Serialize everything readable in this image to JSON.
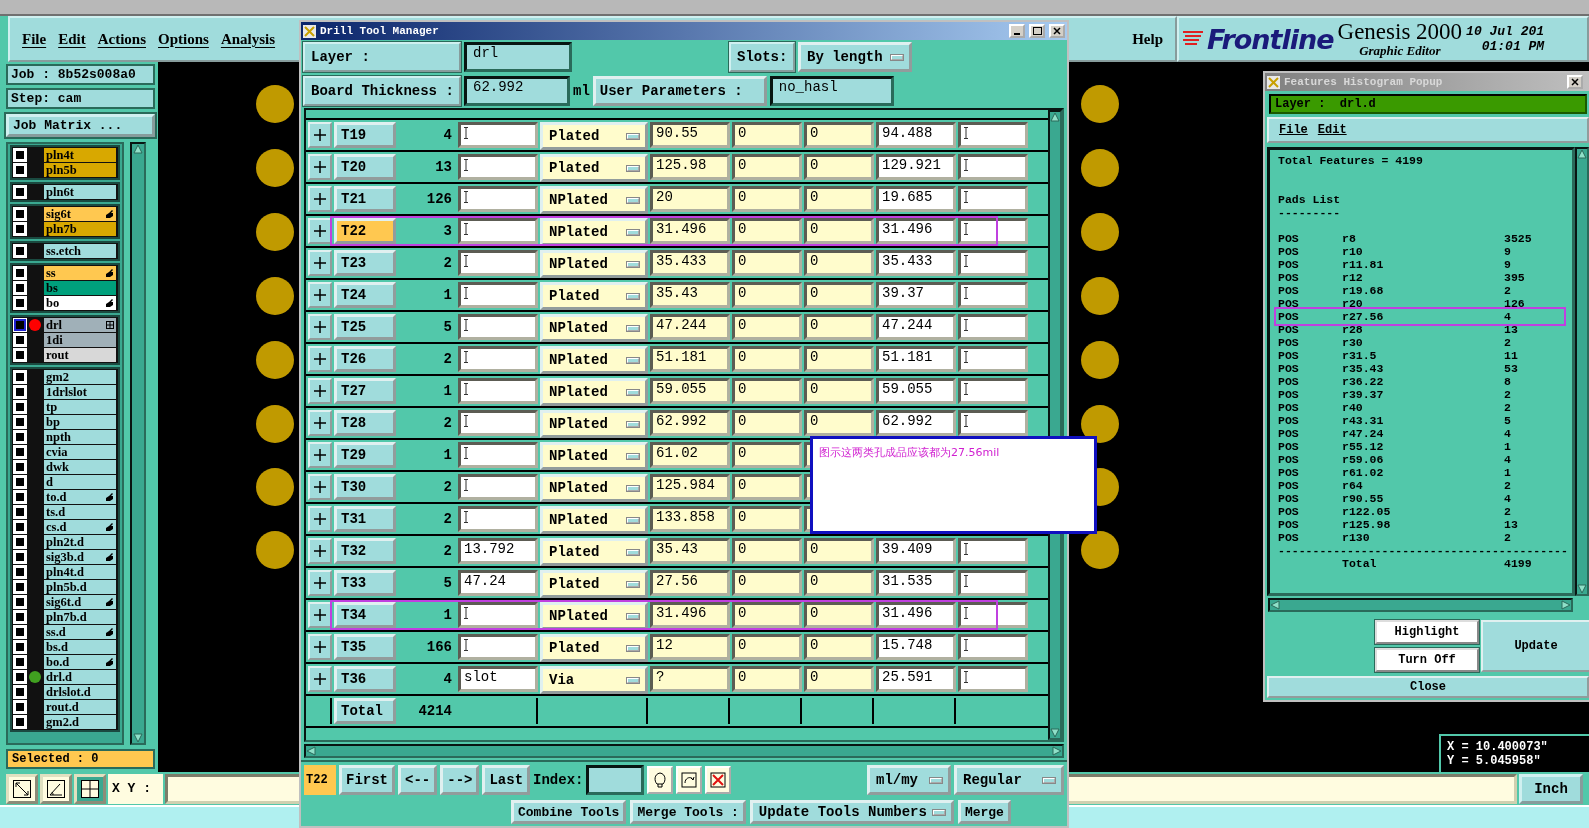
{
  "main_window": {
    "menu": [
      "File",
      "Edit",
      "Actions",
      "Options",
      "Analysis"
    ],
    "help": "Help",
    "logo": {
      "brand": "Frontline",
      "product": "Genesis 2000",
      "subtitle": "Graphic Editor",
      "date": "10 Jul 201",
      "time": "01:01 PM"
    }
  },
  "job_panel": {
    "job": "Job : 8b52s008a0",
    "step": "Step: cam",
    "matrix_button": "Job Matrix ...",
    "selected_count": "Selected : 0",
    "layer_groups": [
      [
        {
          "name": "pln4t",
          "color": "#d8a800",
          "checked": false,
          "selected": false,
          "kind": "plain"
        },
        {
          "name": "pln5b",
          "color": "#d8a800",
          "checked": false,
          "selected": false,
          "kind": "plain"
        }
      ],
      [
        {
          "name": "pln6t",
          "color": "#a0dcdc",
          "checked": false,
          "selected": false,
          "kind": "plain"
        }
      ],
      [
        {
          "name": "sig6t",
          "color": "#ffc850",
          "checked": false,
          "selected": false,
          "kind": "hand"
        },
        {
          "name": "pln7b",
          "color": "#d8a800",
          "checked": false,
          "selected": false,
          "kind": "plain"
        }
      ],
      [
        {
          "name": "ss.etch",
          "color": "#a0dcdc",
          "checked": false,
          "selected": false,
          "kind": "plain"
        }
      ],
      [
        {
          "name": "ss",
          "color": "#ffc850",
          "checked": false,
          "selected": false,
          "kind": "hand"
        },
        {
          "name": "bs",
          "color": "#00a07c",
          "checked": false,
          "selected": false,
          "kind": "plain"
        },
        {
          "name": "bo",
          "color": "#ffffff",
          "checked": false,
          "selected": false,
          "kind": "hand"
        }
      ],
      [
        {
          "name": "drl",
          "color": "#a0b0b8",
          "checked": false,
          "selected": true,
          "dot": {
            "color": "#ff0000"
          },
          "kind": "grid"
        },
        {
          "name": "1di",
          "color": "#a0b0b8",
          "checked": false,
          "selected": false,
          "kind": "plain"
        },
        {
          "name": "rout",
          "color": "#d8d8d8",
          "checked": false,
          "selected": false,
          "kind": "plain"
        }
      ],
      [
        {
          "name": "gm2",
          "color": "#a0dcdc",
          "checked": false,
          "selected": false,
          "kind": "plain"
        },
        {
          "name": "1drlslot",
          "color": "#a0dcdc",
          "checked": false,
          "selected": false,
          "kind": "plain"
        },
        {
          "name": "tp",
          "color": "#a0dcdc",
          "checked": false,
          "selected": false,
          "kind": "plain"
        },
        {
          "name": "bp",
          "color": "#a0dcdc",
          "checked": false,
          "selected": false,
          "kind": "plain"
        },
        {
          "name": "npth",
          "color": "#a0dcdc",
          "checked": false,
          "selected": false,
          "kind": "plain"
        },
        {
          "name": "cvia",
          "color": "#a0dcdc",
          "checked": false,
          "selected": false,
          "kind": "plain"
        },
        {
          "name": "dwk",
          "color": "#a0dcdc",
          "checked": false,
          "selected": false,
          "kind": "plain"
        },
        {
          "name": "d",
          "color": "#a0dcdc",
          "checked": false,
          "selected": false,
          "kind": "plain"
        },
        {
          "name": "to.d",
          "color": "#a0dcdc",
          "checked": false,
          "selected": false,
          "kind": "hand"
        },
        {
          "name": "ts.d",
          "color": "#a0dcdc",
          "checked": false,
          "selected": false,
          "kind": "plain"
        },
        {
          "name": "cs.d",
          "color": "#a0dcdc",
          "checked": false,
          "selected": false,
          "kind": "hand"
        },
        {
          "name": "pln2t.d",
          "color": "#a0dcdc",
          "checked": false,
          "selected": false,
          "kind": "plain"
        },
        {
          "name": "sig3b.d",
          "color": "#a0dcdc",
          "checked": false,
          "selected": false,
          "kind": "hand"
        },
        {
          "name": "pln4t.d",
          "color": "#a0dcdc",
          "checked": false,
          "selected": false,
          "kind": "plain"
        },
        {
          "name": "pln5b.d",
          "color": "#a0dcdc",
          "checked": false,
          "selected": false,
          "kind": "plain"
        },
        {
          "name": "sig6t.d",
          "color": "#a0dcdc",
          "checked": false,
          "selected": false,
          "kind": "hand"
        },
        {
          "name": "pln7b.d",
          "color": "#a0dcdc",
          "checked": false,
          "selected": false,
          "kind": "plain"
        },
        {
          "name": "ss.d",
          "color": "#a0dcdc",
          "checked": false,
          "selected": false,
          "kind": "hand"
        },
        {
          "name": "bs.d",
          "color": "#a0dcdc",
          "checked": false,
          "selected": false,
          "kind": "plain"
        },
        {
          "name": "bo.d",
          "color": "#a0dcdc",
          "checked": false,
          "selected": false,
          "kind": "hand"
        },
        {
          "name": "drl.d",
          "color": "#a0dcdc",
          "checked": false,
          "selected": false,
          "dot": {
            "color": "#40a020"
          },
          "kind": "plain"
        },
        {
          "name": "drlslot.d",
          "color": "#a0dcdc",
          "checked": false,
          "selected": false,
          "kind": "plain"
        },
        {
          "name": "rout.d",
          "color": "#a0dcdc",
          "checked": false,
          "selected": false,
          "kind": "plain"
        },
        {
          "name": "gm2.d",
          "color": "#a0dcdc",
          "checked": false,
          "selected": false,
          "kind": "plain"
        }
      ]
    ]
  },
  "toolbar": {
    "xy_label": "X Y :",
    "unit": "Inch"
  },
  "coordinates": {
    "x": "X = 10.400073\"",
    "y": "Y = 5.045958\""
  },
  "drill_tool_manager": {
    "title": "Drill Tool Manager",
    "layer_label": "Layer :",
    "layer": "drl",
    "slots_label": "Slots:",
    "slots": "By length",
    "thickness_label": "Board Thickness :",
    "thickness": "62.992",
    "thickness_unit": "ml",
    "user_params_button": "User Parameters :",
    "user_params": "no_hasl",
    "rows": [
      {
        "tool": "T19",
        "count": "4",
        "type": "Plated",
        "column_5": "90.55",
        "column_6": "0",
        "column_7": "0",
        "column_8": "94.488",
        "selected": false,
        "circled": false
      },
      {
        "tool": "T20",
        "count": "13",
        "type": "Plated",
        "column_5": "125.98",
        "column_6": "0",
        "column_7": "0",
        "column_8": "129.921",
        "selected": false,
        "circled": false
      },
      {
        "tool": "T21",
        "count": "126",
        "type": "NPlated",
        "column_5": "20",
        "column_6": "0",
        "column_7": "0",
        "column_8": "19.685",
        "selected": false,
        "circled": false
      },
      {
        "tool": "T22",
        "count": "3",
        "type": "NPlated",
        "column_5": "31.496",
        "column_6": "0",
        "column_7": "0",
        "column_8": "31.496",
        "selected": true,
        "circled": true
      },
      {
        "tool": "T23",
        "count": "2",
        "type": "NPlated",
        "column_5": "35.433",
        "column_6": "0",
        "column_7": "0",
        "column_8": "35.433",
        "selected": false,
        "circled": false
      },
      {
        "tool": "T24",
        "count": "1",
        "type": "Plated",
        "column_5": "35.43",
        "column_6": "0",
        "column_7": "0",
        "column_8": "39.37",
        "selected": false,
        "circled": false
      },
      {
        "tool": "T25",
        "count": "5",
        "type": "NPlated",
        "column_5": "47.244",
        "column_6": "0",
        "column_7": "0",
        "column_8": "47.244",
        "selected": false,
        "circled": false
      },
      {
        "tool": "T26",
        "count": "2",
        "type": "NPlated",
        "column_5": "51.181",
        "column_6": "0",
        "column_7": "0",
        "column_8": "51.181",
        "selected": false,
        "circled": false
      },
      {
        "tool": "T27",
        "count": "1",
        "type": "NPlated",
        "column_5": "59.055",
        "column_6": "0",
        "column_7": "0",
        "column_8": "59.055",
        "selected": false,
        "circled": false
      },
      {
        "tool": "T28",
        "count": "2",
        "type": "NPlated",
        "column_5": "62.992",
        "column_6": "0",
        "column_7": "0",
        "column_8": "62.992",
        "selected": false,
        "circled": false
      },
      {
        "tool": "T29",
        "count": "1",
        "type": "NPlated",
        "column_5": "61.02",
        "column_6": "0",
        "selected": false,
        "circled": false
      },
      {
        "tool": "T30",
        "count": "2",
        "type": "NPlated",
        "column_5": "125.984",
        "column_6": "0",
        "selected": false,
        "circled": false
      },
      {
        "tool": "T31",
        "count": "2",
        "type": "NPlated",
        "column_5": "133.858",
        "column_6": "0",
        "selected": false,
        "circled": false
      },
      {
        "tool": "T32",
        "count": "2",
        "column_3": "13.792",
        "type": "Plated",
        "column_5": "35.43",
        "column_6": "0",
        "column_7": "0",
        "column_8": "39.409",
        "selected": false,
        "circled": false
      },
      {
        "tool": "T33",
        "count": "5",
        "column_3": "47.24",
        "type": "Plated",
        "column_5": "27.56",
        "column_6": "0",
        "column_7": "0",
        "column_8": "31.535",
        "selected": false,
        "circled": false
      },
      {
        "tool": "T34",
        "count": "1",
        "type": "NPlated",
        "column_5": "31.496",
        "column_6": "0",
        "column_7": "0",
        "column_8": "31.496",
        "selected": false,
        "circled": true
      },
      {
        "tool": "T35",
        "count": "166",
        "type": "Plated",
        "column_5": "12",
        "column_6": "0",
        "column_7": "0",
        "column_8": "15.748",
        "selected": false,
        "circled": false
      },
      {
        "tool": "T36",
        "count": "4",
        "column_3": "slot",
        "type": "Via",
        "column_5": "?",
        "column_6": "0",
        "column_7": "0",
        "column_8": "25.591",
        "selected": false,
        "circled": false
      }
    ],
    "total_label": "Total",
    "total": "4214",
    "current_tool": "T22",
    "nav_buttons": [
      "First",
      "<--",
      "-->",
      "Last"
    ],
    "index_label": "Index:",
    "units": "ml/my",
    "mode": "Regular",
    "bottom_buttons": [
      {
        "label": "Combine Tools",
        "kind": "button"
      },
      {
        "label": "Merge Tools :",
        "kind": "button"
      },
      {
        "label": "Update Tools Numbers",
        "kind": "dropdown"
      },
      {
        "label": "Merge",
        "kind": "button"
      }
    ]
  },
  "annotation": {
    "text": "图示这两类孔成品应该都为27.56mil"
  },
  "histogram": {
    "title": "Features Histogram Popup",
    "layer": "Layer :  drl.d",
    "menu": [
      "File",
      "Edit"
    ],
    "total_features": "Total Features = 4199",
    "section": "Pads List",
    "section_rule": "---------",
    "rows": [
      {
        "polarity": "POS",
        "symbol": "r8",
        "count": "3525",
        "circled": false
      },
      {
        "polarity": "POS",
        "symbol": "r10",
        "count": "9",
        "circled": false
      },
      {
        "polarity": "POS",
        "symbol": "r11.81",
        "count": "9",
        "circled": false
      },
      {
        "polarity": "POS",
        "symbol": "r12",
        "count": "395",
        "circled": false
      },
      {
        "polarity": "POS",
        "symbol": "r19.68",
        "count": "2",
        "circled": false
      },
      {
        "polarity": "POS",
        "symbol": "r20",
        "count": "126",
        "circled": false
      },
      {
        "polarity": "POS",
        "symbol": "r27.56",
        "count": "4",
        "circled": true
      },
      {
        "polarity": "POS",
        "symbol": "r28",
        "count": "13",
        "circled": false
      },
      {
        "polarity": "POS",
        "symbol": "r30",
        "count": "2",
        "circled": false
      },
      {
        "polarity": "POS",
        "symbol": "r31.5",
        "count": "11",
        "circled": false
      },
      {
        "polarity": "POS",
        "symbol": "r35.43",
        "count": "53",
        "circled": false
      },
      {
        "polarity": "POS",
        "symbol": "r36.22",
        "count": "8",
        "circled": false
      },
      {
        "polarity": "POS",
        "symbol": "r39.37",
        "count": "2",
        "circled": false
      },
      {
        "polarity": "POS",
        "symbol": "r40",
        "count": "2",
        "circled": false
      },
      {
        "polarity": "POS",
        "symbol": "r43.31",
        "count": "5",
        "circled": false
      },
      {
        "polarity": "POS",
        "symbol": "r47.24",
        "count": "4",
        "circled": false
      },
      {
        "polarity": "POS",
        "symbol": "r55.12",
        "count": "1",
        "circled": false
      },
      {
        "polarity": "POS",
        "symbol": "r59.06",
        "count": "4",
        "circled": false
      },
      {
        "polarity": "POS",
        "symbol": "r61.02",
        "count": "1",
        "circled": false
      },
      {
        "polarity": "POS",
        "symbol": "r64",
        "count": "2",
        "circled": false
      },
      {
        "polarity": "POS",
        "symbol": "r90.55",
        "count": "4",
        "circled": false
      },
      {
        "polarity": "POS",
        "symbol": "r122.05",
        "count": "2",
        "circled": false
      },
      {
        "polarity": "POS",
        "symbol": "r125.98",
        "count": "13",
        "circled": false
      },
      {
        "polarity": "POS",
        "symbol": "r130",
        "count": "2",
        "circled": false
      }
    ],
    "total_rule": "------------------------------------------",
    "total_label": "Total",
    "total": "4199",
    "buttons": {
      "highlight": "Highlight",
      "turn_off": "Turn Off",
      "update": "Update",
      "close": "Close"
    }
  }
}
